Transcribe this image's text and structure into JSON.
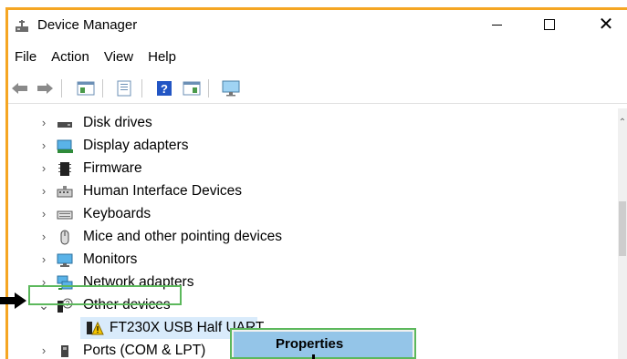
{
  "window": {
    "title": "Device Manager",
    "minimize_glyph": "",
    "close_glyph": "✕"
  },
  "menu": [
    "File",
    "Action",
    "View",
    "Help"
  ],
  "tree": {
    "categories": [
      {
        "label": "Disk drives",
        "icon": "disk-drive-icon",
        "expanded": false
      },
      {
        "label": "Display adapters",
        "icon": "display-adapter-icon",
        "expanded": false
      },
      {
        "label": "Firmware",
        "icon": "firmware-icon",
        "expanded": false
      },
      {
        "label": "Human Interface Devices",
        "icon": "hid-icon",
        "expanded": false
      },
      {
        "label": "Keyboards",
        "icon": "keyboard-icon",
        "expanded": false
      },
      {
        "label": "Mice and other pointing devices",
        "icon": "mouse-icon",
        "expanded": false
      },
      {
        "label": "Monitors",
        "icon": "monitor-icon",
        "expanded": false
      },
      {
        "label": "Network adapters",
        "icon": "network-adapter-icon",
        "expanded": false
      },
      {
        "label": "Other devices",
        "icon": "unknown-device-icon",
        "expanded": true
      }
    ],
    "child": {
      "label": "FT230X USB Half UART",
      "icon": "warning-device-icon"
    },
    "after": {
      "label": "Ports (COM & LPT)",
      "icon": "port-icon",
      "expanded": false
    }
  },
  "context_menu": {
    "items": [
      "Properties"
    ]
  },
  "colors": {
    "annotation_orange": "#f5a623",
    "annotation_green": "#5cb85c",
    "selection_blue": "#d9ebfb",
    "menu_hover_blue": "#94c5e8"
  }
}
